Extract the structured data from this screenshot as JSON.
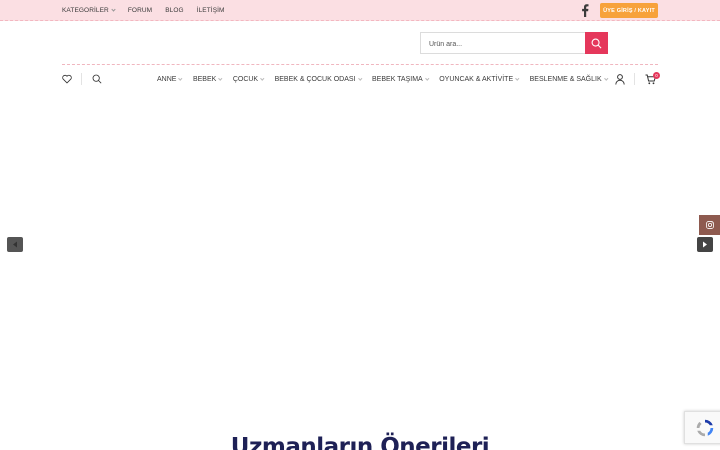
{
  "topbar": {
    "menu": [
      {
        "label": "KATEGORİLER",
        "dropdown": true
      },
      {
        "label": "FORUM",
        "dropdown": false
      },
      {
        "label": "BLOG",
        "dropdown": false
      },
      {
        "label": "İLETİŞİM",
        "dropdown": false
      }
    ],
    "social_icon": "facebook-icon",
    "login_label": "ÜYE GİRİŞ / KAYIT"
  },
  "search": {
    "placeholder": "Ürün ara...",
    "button_icon": "search-icon"
  },
  "nav": {
    "items": [
      {
        "label": "ANNE"
      },
      {
        "label": "BEBEK"
      },
      {
        "label": "ÇOCUK"
      },
      {
        "label": "BEBEK & ÇOCUK ODASI"
      },
      {
        "label": "BEBEK TAŞIMA"
      },
      {
        "label": "OYUNCAK & AKTİVİTE"
      },
      {
        "label": "BESLENME & SAĞLIK"
      }
    ],
    "cart_count": "0"
  },
  "section": {
    "title": "Uzmanların Önerileri"
  },
  "colors": {
    "topbar_bg": "#fbdfe3",
    "accent": "#e5375b",
    "login_button": "#f7a23b",
    "title": "#1e2156"
  }
}
